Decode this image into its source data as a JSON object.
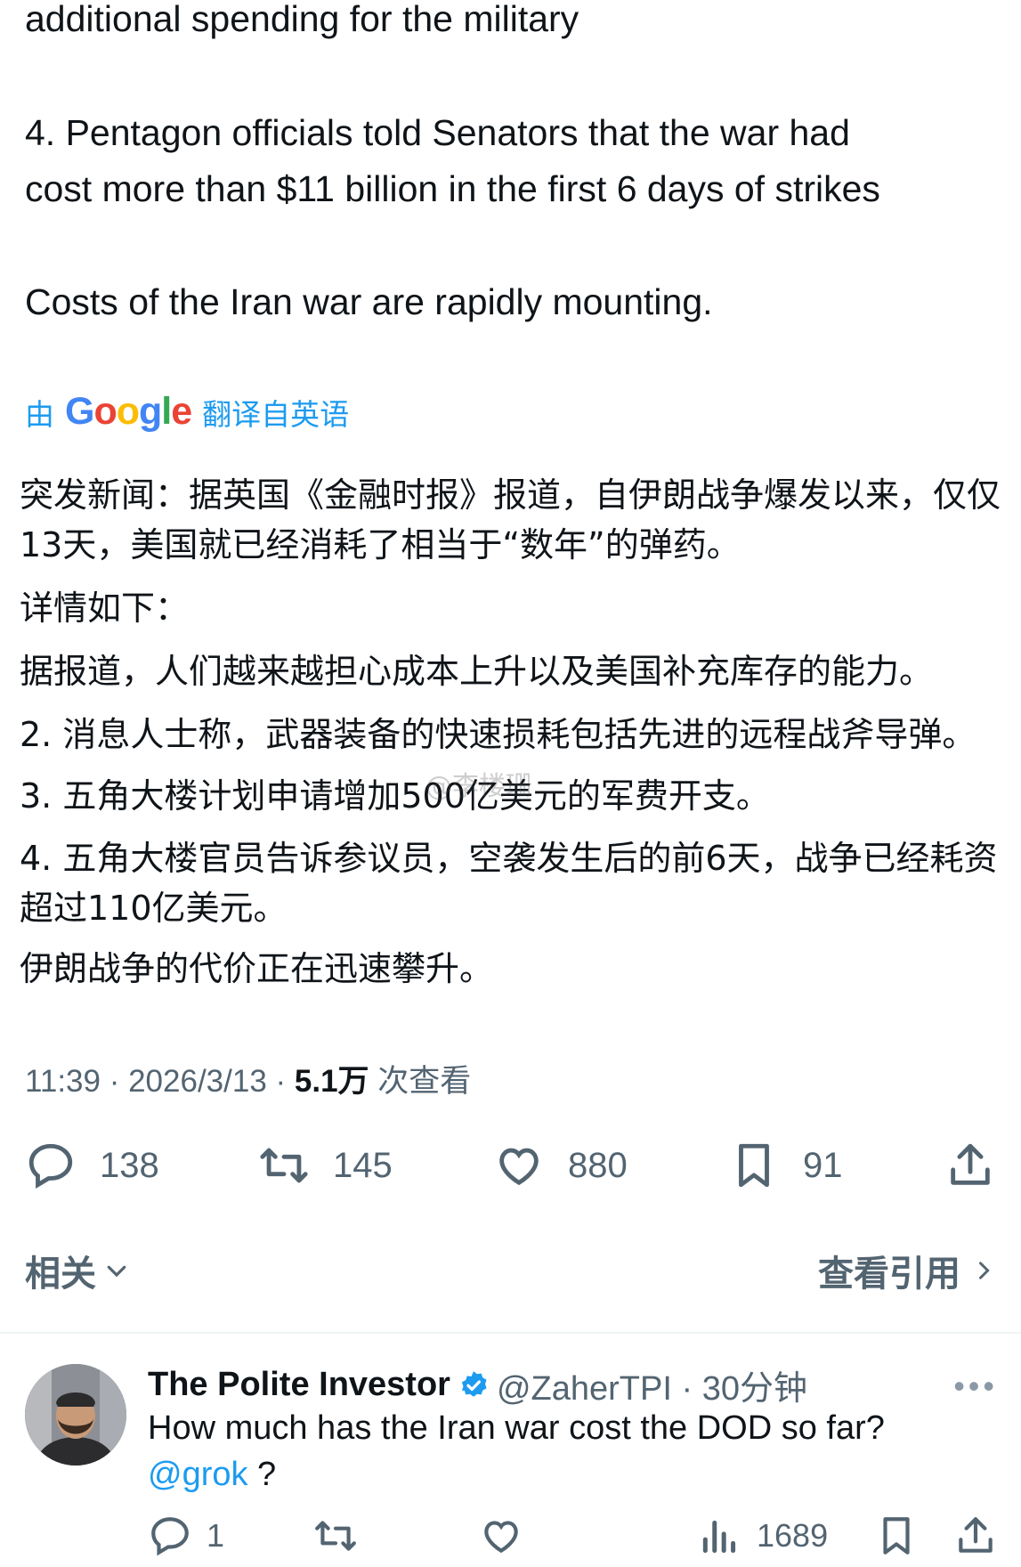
{
  "tweet": {
    "en_line_1": "additional spending for the military",
    "en_line_2a": "4. Pentagon officials told Senators that the war had",
    "en_line_2b": "cost more than $11 billion in the first 6 days of strikes",
    "en_line_3": "Costs of the Iran war are rapidly mounting.",
    "translate_prefix": "由",
    "translate_brand": "Google",
    "translate_suffix": "翻译自英语",
    "zh": [
      "突发新闻：据英国《金融时报》报道，自伊朗战争爆发以来，仅仅13天，美国就已经消耗了相当于“数年”的弹药。",
      "详情如下：",
      "据报道，人们越来越担心成本上升以及美国补充库存的能力。",
      "2. 消息人士称，武器装备的快速损耗包括先进的远程战斧导弹。",
      "3. 五角大楼计划申请增加500亿美元的军费开支。",
      "4. 五角大楼官员告诉参议员，空袭发生后的前6天，战争已经耗资超过110亿美元。",
      "伊朗战争的代价正在迅速攀升。"
    ],
    "watermark": "@李楼珊",
    "time": "11:39 · 2026/3/13 · ",
    "views_count": "5.1万",
    "views_label": " 次查看",
    "stats": {
      "replies": "138",
      "retweets": "145",
      "likes": "880",
      "bookmarks": "91"
    },
    "related_label": "相关",
    "quotes_label": "查看引用"
  },
  "reply": {
    "name": "The Polite Investor",
    "handle": "@ZaherTPI · 30分钟",
    "text": "How much has the Iran war cost the DOD so far?",
    "mention": "@grok",
    "text_end": " ?",
    "replies": "1",
    "views": "1689"
  },
  "colors": {
    "accent": "#1d9bf0",
    "muted": "#536471",
    "text": "#0f1419"
  },
  "icons": [
    "reply-icon",
    "retweet-icon",
    "heart-icon",
    "bookmark-icon",
    "share-icon",
    "chevron-down-icon",
    "chevron-right-icon",
    "verified-icon",
    "more-icon",
    "views-icon"
  ]
}
